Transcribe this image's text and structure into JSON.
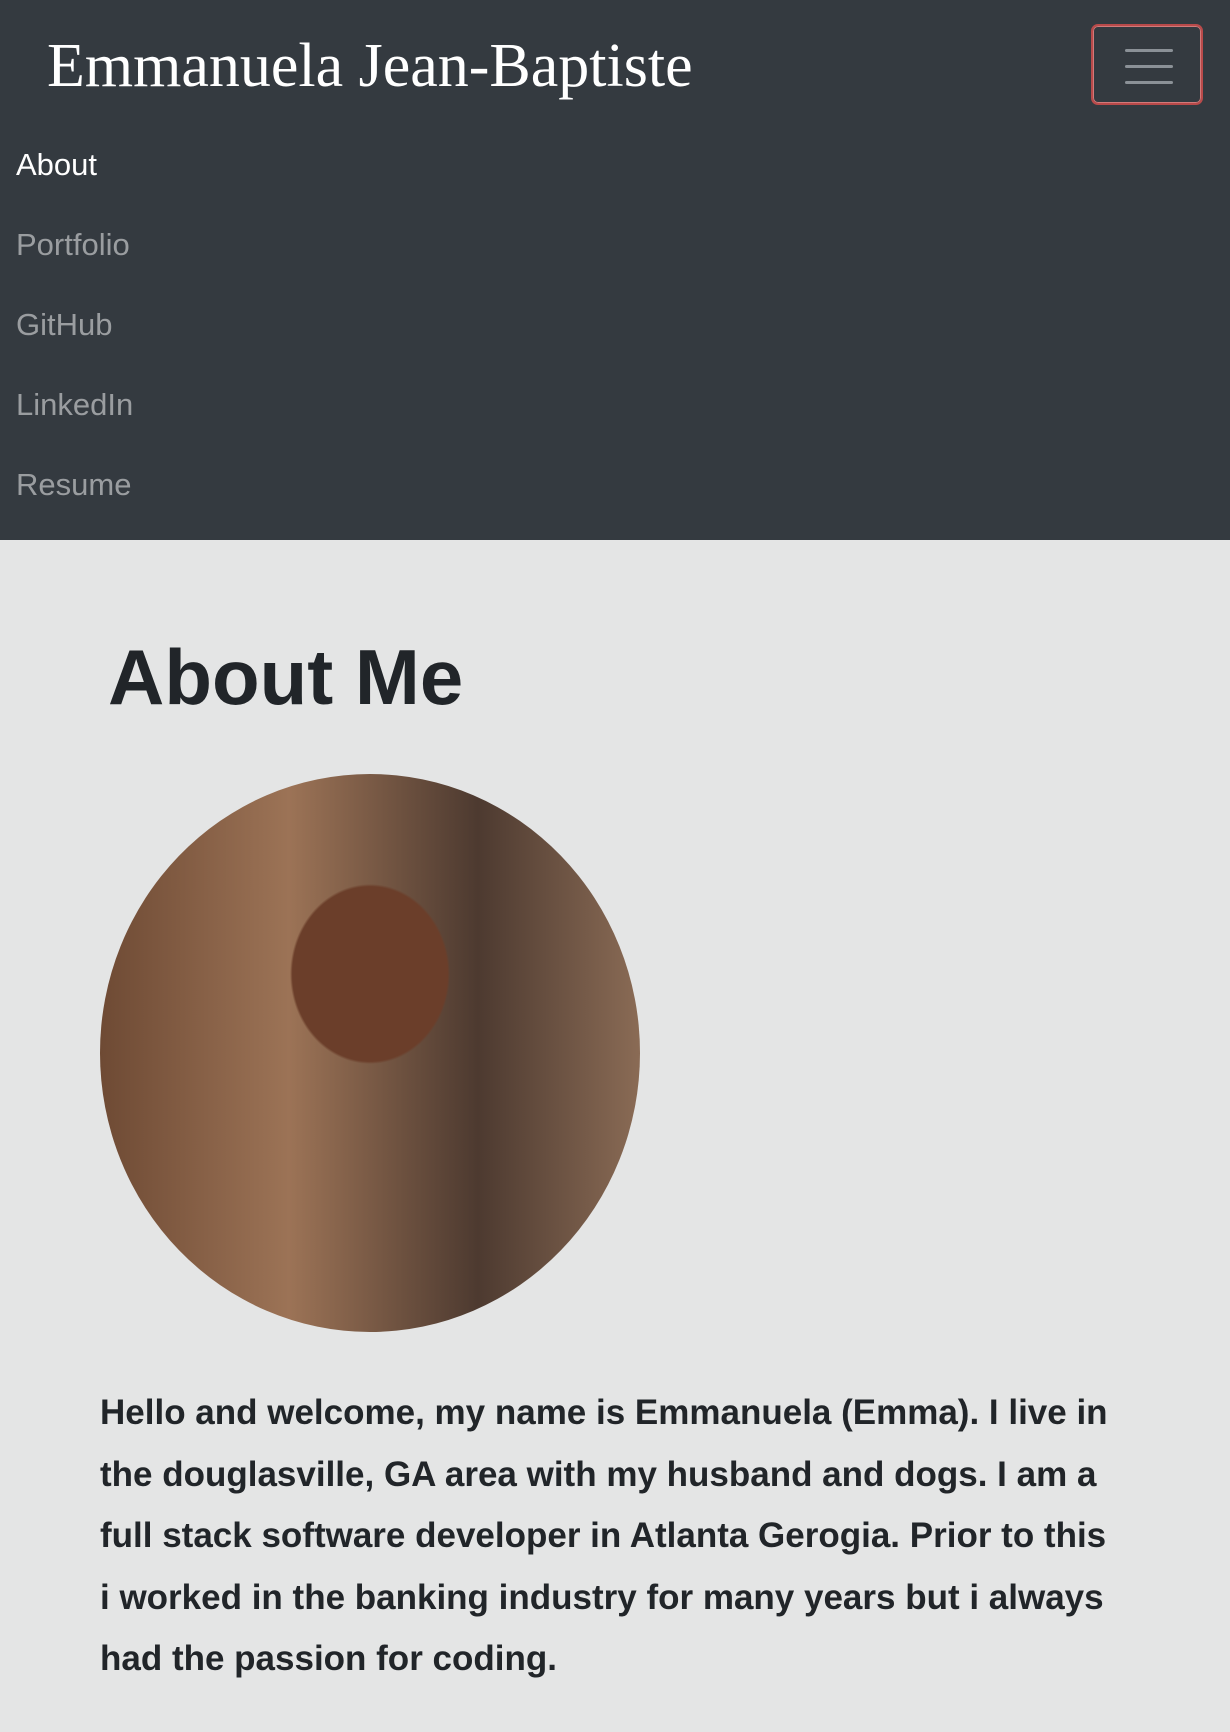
{
  "navbar": {
    "brand": "Emmanuela Jean-Baptiste",
    "toggler_icon": "hamburger-menu-icon",
    "items": [
      {
        "label": "About",
        "active": true
      },
      {
        "label": "Portfolio",
        "active": false
      },
      {
        "label": "GitHub",
        "active": false
      },
      {
        "label": "LinkedIn",
        "active": false
      },
      {
        "label": "Resume",
        "active": false
      }
    ]
  },
  "about": {
    "title": "About Me",
    "bio": "Hello and welcome, my name is Emmanuela (Emma). I live in the douglasville, GA area with my husband and dogs. I am a full stack software developer in Atlanta Gerogia. Prior to this i worked in the banking industry for many years but i always had the passion for coding."
  },
  "colors": {
    "navbar_bg": "#343a40",
    "page_bg": "#e4e5e5",
    "nav_active": "#ffffff",
    "nav_inactive": "#9a9da0",
    "text": "#212529",
    "toggler_border": "#b94a4a"
  }
}
